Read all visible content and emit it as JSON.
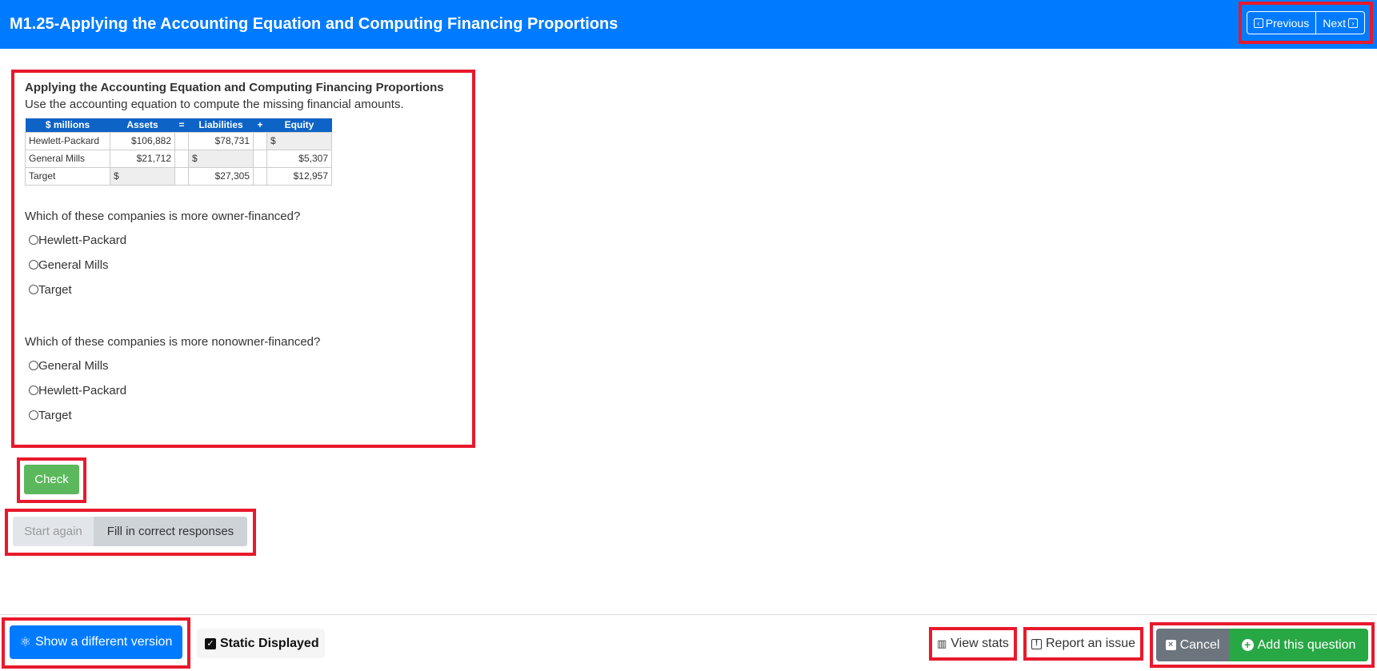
{
  "header": {
    "title": "M1.25-Applying the Accounting Equation and Computing Financing Proportions",
    "previous_label": "Previous",
    "next_label": "Next"
  },
  "question": {
    "title": "Applying the Accounting Equation and Computing Financing Proportions",
    "instruction": "Use the accounting equation to compute the missing financial amounts.",
    "table": {
      "headers": [
        "$ millions",
        "Assets",
        "=",
        "Liabilities",
        "+",
        "Equity"
      ],
      "rows": [
        {
          "name": "Hewlett-Packard",
          "assets": "$106,882",
          "liabilities": "$78,731",
          "equity": "$"
        },
        {
          "name": "General Mills",
          "assets": "$21,712",
          "liabilities": "$",
          "equity": "$5,307"
        },
        {
          "name": "Target",
          "assets": "$",
          "liabilities": "$27,305",
          "equity": "$12,957"
        }
      ]
    },
    "q1": {
      "text": "Which of these companies is more owner-financed?",
      "options": [
        "Hewlett-Packard",
        "General Mills",
        "Target"
      ]
    },
    "q2": {
      "text": "Which of these companies is more nonowner-financed?",
      "options": [
        "General Mills",
        "Hewlett-Packard",
        "Target"
      ]
    }
  },
  "actions": {
    "check": "Check",
    "start_again": "Start again",
    "fill_in": "Fill in correct responses"
  },
  "footer": {
    "show_different": "Show a different version",
    "static_displayed": "Static Displayed",
    "view_stats": "View stats",
    "report_issue": "Report an issue",
    "cancel": "Cancel",
    "add_question": "Add this question"
  },
  "colors": {
    "primary": "#007bff",
    "table_header": "#0d63c6",
    "check_green": "#5cb85c",
    "add_green": "#28a745",
    "cancel_gray": "#6c757d",
    "highlight_red": "#e8192c"
  }
}
